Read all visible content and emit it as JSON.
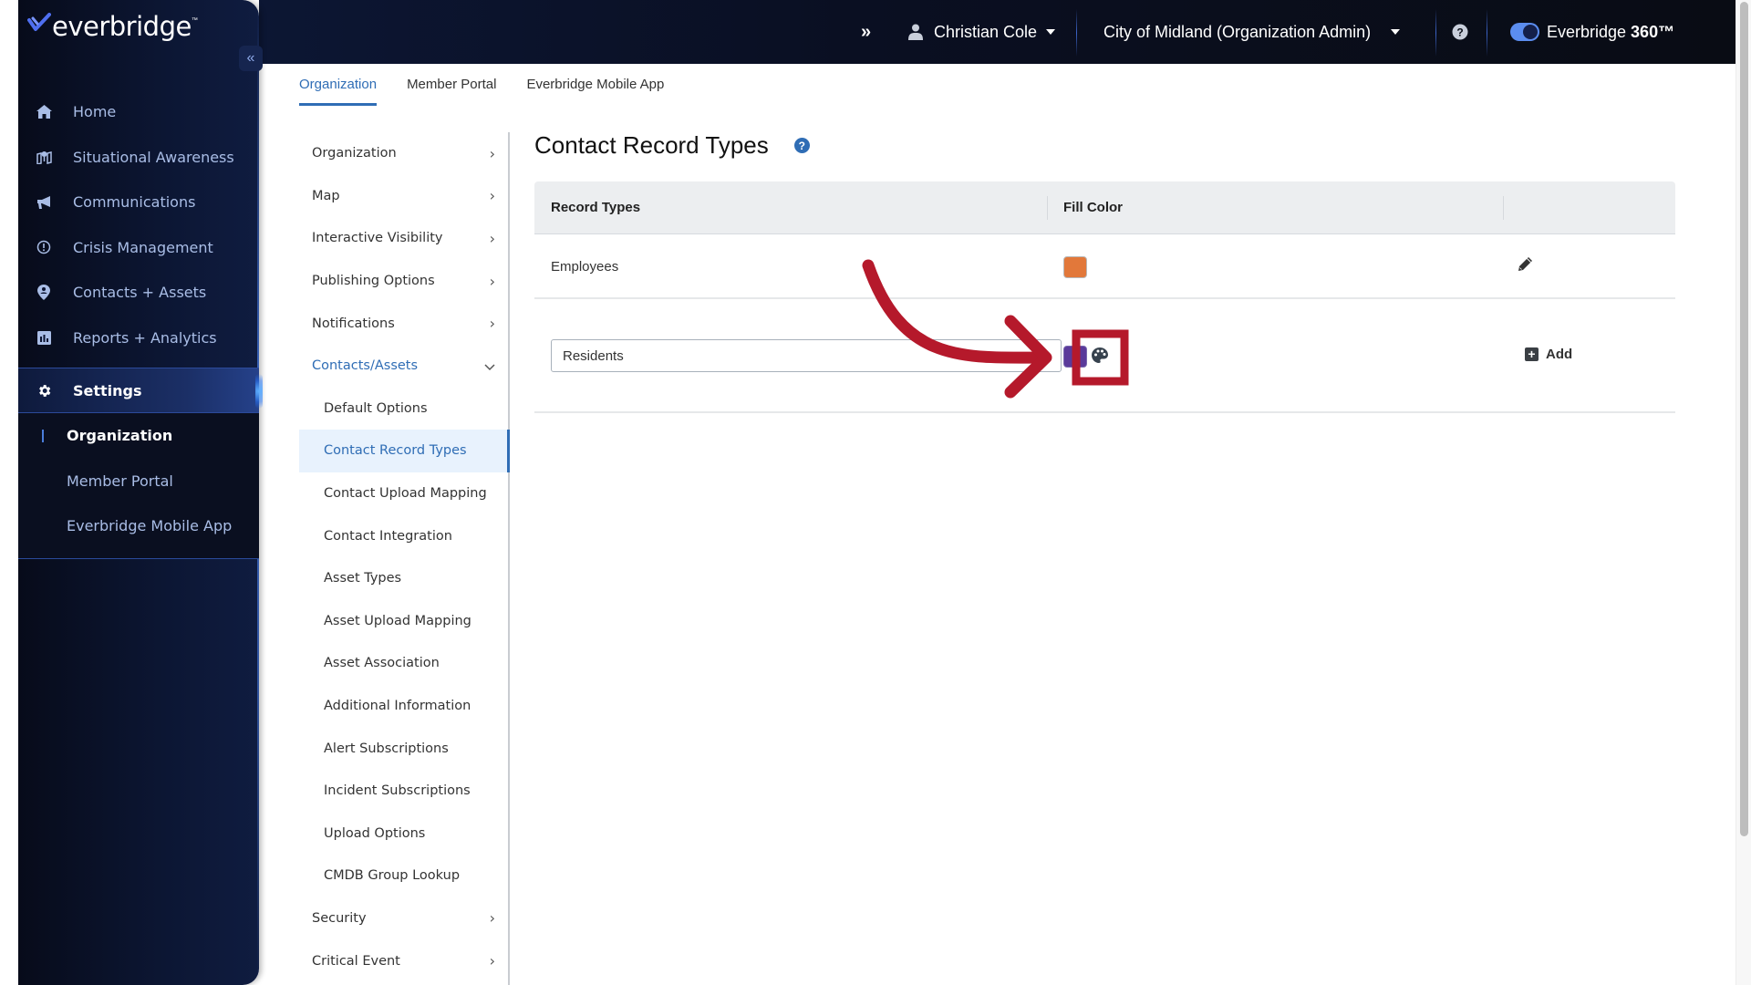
{
  "brand": {
    "name": "everbridge",
    "accent": "#2f6db5"
  },
  "sidebar": {
    "collapse_label": "«",
    "items": [
      {
        "label": "Home",
        "icon": "home-icon"
      },
      {
        "label": "Situational Awareness",
        "icon": "map-pin-icon"
      },
      {
        "label": "Communications",
        "icon": "megaphone-icon"
      },
      {
        "label": "Crisis Management",
        "icon": "alert-circle-icon"
      },
      {
        "label": "Contacts + Assets",
        "icon": "contact-pin-icon"
      },
      {
        "label": "Reports + Analytics",
        "icon": "bar-chart-icon"
      },
      {
        "label": "Settings",
        "icon": "gear-icon",
        "active": true
      }
    ],
    "sub_items": [
      {
        "label": "Organization",
        "active": true
      },
      {
        "label": "Member Portal"
      },
      {
        "label": "Everbridge Mobile App"
      }
    ]
  },
  "topbar": {
    "expand_label": "»",
    "user": "Christian Cole",
    "organization": "City of Midland (Organization Admin)",
    "product_prefix": "Everbridge",
    "product_suffix": "360™",
    "toggle_on": true
  },
  "tabs": [
    {
      "label": "Organization",
      "active": true
    },
    {
      "label": "Member Portal"
    },
    {
      "label": "Everbridge Mobile App"
    }
  ],
  "secondary_nav": {
    "sections": [
      {
        "label": "Organization",
        "chevron": "›"
      },
      {
        "label": "Map",
        "chevron": "›"
      },
      {
        "label": "Interactive Visibility",
        "chevron": "›"
      },
      {
        "label": "Publishing Options",
        "chevron": "›"
      },
      {
        "label": "Notifications",
        "chevron": "›"
      },
      {
        "label": "Contacts/Assets",
        "chevron": "⌄",
        "open": true
      }
    ],
    "children": [
      {
        "label": "Default Options"
      },
      {
        "label": "Contact Record Types",
        "active": true
      },
      {
        "label": "Contact Upload Mapping"
      },
      {
        "label": "Contact Integration"
      },
      {
        "label": "Asset Types"
      },
      {
        "label": "Asset Upload Mapping"
      },
      {
        "label": "Asset Association"
      },
      {
        "label": "Additional Information"
      },
      {
        "label": "Alert Subscriptions"
      },
      {
        "label": "Incident Subscriptions"
      },
      {
        "label": "Upload Options"
      },
      {
        "label": "CMDB Group Lookup"
      }
    ],
    "after": [
      {
        "label": "Security",
        "chevron": "›"
      },
      {
        "label": "Critical Event",
        "chevron": "›"
      }
    ]
  },
  "main": {
    "title": "Contact Record Types",
    "help": "?",
    "table": {
      "columns": [
        "Record Types",
        "Fill Color",
        ""
      ],
      "rows": [
        {
          "name": "Employees",
          "fill_color": "#e2783a",
          "action": "edit"
        }
      ],
      "new_row": {
        "input_value": "Residents",
        "fill_color": "#5a3a9a",
        "add_label": "Add"
      }
    }
  },
  "annotation": {
    "color": "#b5192b",
    "target": "color-palette-button"
  }
}
